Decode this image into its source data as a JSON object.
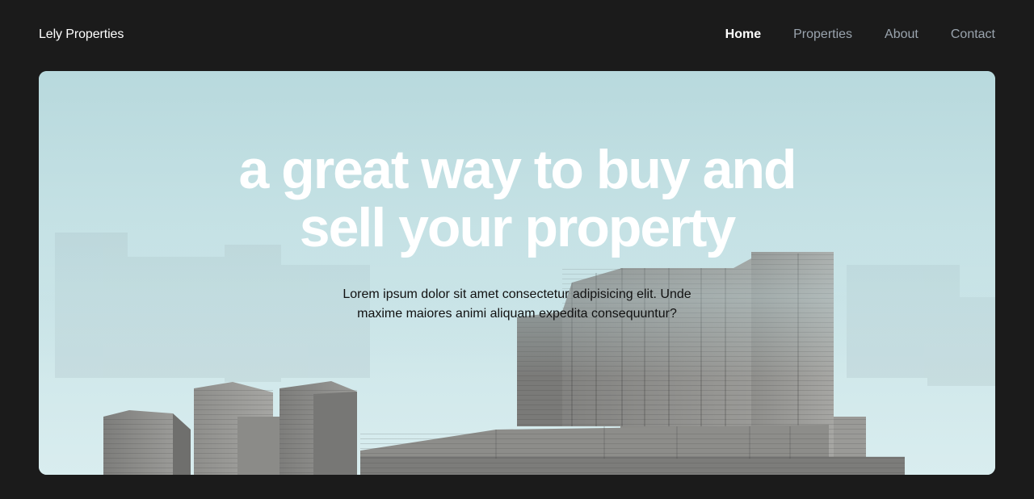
{
  "brand": {
    "name": "Lely Properties"
  },
  "nav": {
    "items": [
      {
        "label": "Home",
        "active": true
      },
      {
        "label": "Properties",
        "active": false
      },
      {
        "label": "About",
        "active": false
      },
      {
        "label": "Contact",
        "active": false
      }
    ]
  },
  "hero": {
    "title_line1": "a great way to buy and",
    "title_line2": "sell your property",
    "subtitle": "Lorem ipsum dolor sit amet consectetur adipisicing elit. Unde maxime maiores animi aliquam expedita consequuntur?",
    "image": "concrete-buildings-photo"
  },
  "colors": {
    "page_bg": "#1b1b1b",
    "nav_active": "#ffffff",
    "nav_inactive": "#9aa4ae",
    "sky": "#c8e3e6",
    "concrete": "#8a8a88"
  }
}
